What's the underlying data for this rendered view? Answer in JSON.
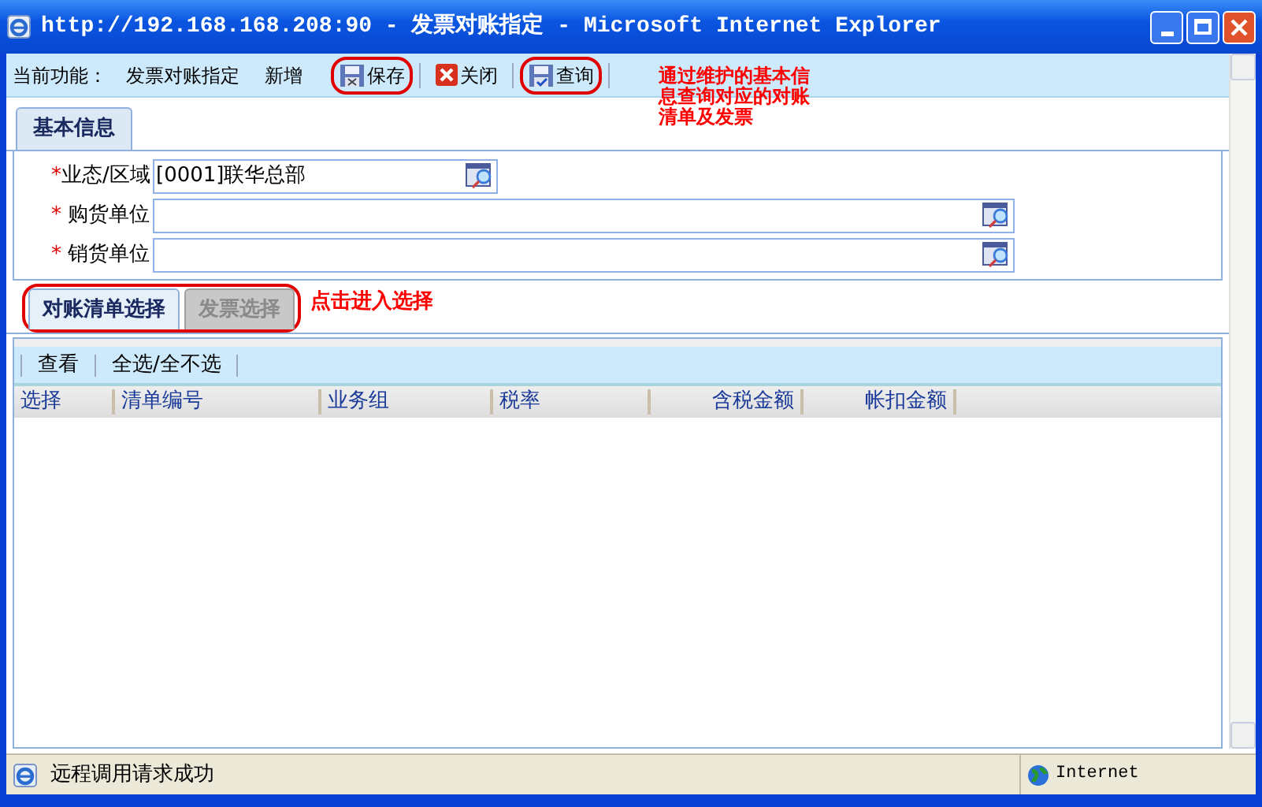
{
  "window": {
    "title": "http://192.168.168.208:90 - 发票对账指定 - Microsoft Internet Explorer"
  },
  "toolbar": {
    "function_label": "当前功能：",
    "function_name": "发票对账指定",
    "mode": "新增",
    "buttons": [
      {
        "label": "保存",
        "kind": "save",
        "circled": true
      },
      {
        "label": "关闭",
        "kind": "close",
        "circled": false
      },
      {
        "label": "查询",
        "kind": "query",
        "circled": true
      }
    ]
  },
  "toolbar_note": "通过维护的基本信息查询对应的对账清单及发票",
  "section_tab": "基本信息",
  "fields": [
    {
      "label": "业态/区域",
      "required_mark": "*",
      "value": "[0001]联华总部",
      "kind": "short"
    },
    {
      "label": "购货单位",
      "required_mark": "*",
      "kind": "long"
    },
    {
      "label": "销货单位",
      "required_mark": "*",
      "kind": "long"
    }
  ],
  "subtabs": {
    "circled": true,
    "note": "点击进入选择",
    "items": [
      {
        "label": "对账清单选择",
        "selected": true
      },
      {
        "label": "发票选择",
        "selected": false
      }
    ]
  },
  "grid_toolbar": [
    "查看",
    "全选/全不选"
  ],
  "columns": [
    {
      "label": "选择"
    },
    {
      "label": "清单编号"
    },
    {
      "label": "业务组"
    },
    {
      "label": "税率"
    },
    {
      "label": "含税金额"
    },
    {
      "label": "帐扣金额"
    }
  ],
  "status_bar": {
    "message": "远程调用请求成功",
    "zone": "Internet"
  }
}
